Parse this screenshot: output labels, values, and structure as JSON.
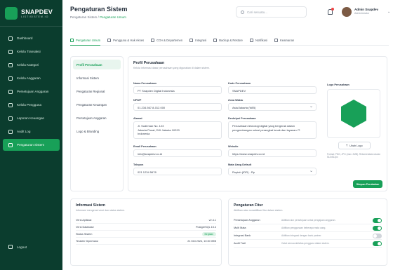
{
  "sidebar": {
    "brand": "SNAPDEV",
    "tagline": "L I S T I   S I S T E M . I O",
    "items": [
      {
        "label": "Dashboard",
        "icon": "home-icon"
      },
      {
        "label": "Kelola Transaksi",
        "icon": "receipt-icon"
      },
      {
        "label": "Kelola Kategori",
        "icon": "folder-icon"
      },
      {
        "label": "Kelola Anggaran",
        "icon": "wallet-icon"
      },
      {
        "label": "Persetujuan Anggaran",
        "icon": "check-circle-icon"
      },
      {
        "label": "Kelola Pengguna",
        "icon": "users-icon"
      },
      {
        "label": "Laporan Keuangan",
        "icon": "chart-icon"
      },
      {
        "label": "Audit Log",
        "icon": "clipboard-icon"
      },
      {
        "label": "Pengaturan Sistem",
        "icon": "gear-icon"
      }
    ],
    "active_index": 8,
    "logout": "Logout"
  },
  "header": {
    "title": "Pengaturan Sistem",
    "breadcrumb_root": "Pengaturan Sistem",
    "breadcrumb_sep": "/",
    "breadcrumb_current": "Pengaturan Umum",
    "search_placeholder": "Cari sesuatu...",
    "user_name": "Admin Snapdev",
    "user_role": "Administrator"
  },
  "tabs": [
    {
      "label": "Pengaturan Umum",
      "icon": "gear-icon"
    },
    {
      "label": "Pengguna & Hak Akses",
      "icon": "users-icon"
    },
    {
      "label": "COA & Departemen",
      "icon": "book-icon"
    },
    {
      "label": "Integrasi",
      "icon": "link-icon"
    },
    {
      "label": "Backup & Restore",
      "icon": "database-icon"
    },
    {
      "label": "Notifikasi",
      "icon": "bell-icon"
    },
    {
      "label": "Keamanan",
      "icon": "shield-icon"
    }
  ],
  "subnav": [
    "Profil Perusahaan",
    "Informasi Sistem",
    "Pengaturan Regional",
    "Pengaturan Keuangan",
    "Persetujuan Anggaran",
    "Logo & Branding"
  ],
  "profile": {
    "title": "Profil Perusahaan",
    "subtitle": "Kelola informasi dasar perusahaan yang digunakan di dalam sistem.",
    "fields": {
      "nama_label": "Nama Perusahaan",
      "nama_value": "PT Snapdev Digital Indonesia",
      "kode_label": "Kode Perusahaan",
      "kode_value": "SNAPDEV",
      "npwp_label": "NPWP",
      "npwp_value": "01.234.567.8-012.000",
      "zona_label": "Zona Waktu",
      "zona_value": "Asia/Jakarta (WIB)",
      "alamat_label": "Alamat",
      "alamat_value": "Jl. Sudirman No. 123\nJakarta Pusat, DKI Jakarta 10220\nIndonesia",
      "desk_label": "Deskripsi Perusahaan",
      "desk_value": "Perusahaan teknologi digital yang bergerak dalam\npengembangan solusi perangkat lunak dan layanan IT.",
      "email_label": "Email Perusahaan",
      "email_value": "info@snapdev.co.id",
      "website_label": "Website",
      "website_value": "https://www.snapdev.co.id",
      "telepon_label": "Telepon",
      "telepon_value": "021 1234 5678",
      "mata_label": "Mata Uang Default",
      "mata_value": "Rupiah (IDR) - Rp"
    },
    "logo_label": "Logo Perusahaan",
    "upload_label": "Ubah Logo",
    "upload_note": "Format: PNG, JPG (max. 2MB). Rekomendasi ukuran 512x512px",
    "save_label": "Simpan Perubahan"
  },
  "sysinfo": {
    "title": "Informasi Sistem",
    "subtitle": "Informasi mengenai versi dan status sistem.",
    "rows": [
      {
        "label": "Versi Aplikasi",
        "value": "v2.4.1"
      },
      {
        "label": "Versi Database",
        "value": "PostgreSQL 15.4"
      },
      {
        "label": "Status Sistem",
        "value": "Berjalan",
        "badge": true
      },
      {
        "label": "Terakhir Diperbarui",
        "value": "21 Mei 2024, 10:30 WIB"
      }
    ]
  },
  "features": {
    "title": "Pengaturan Fitur",
    "subtitle": "Aktifkan atau nonaktifkan fitur dalam sistem.",
    "rows": [
      {
        "label": "Persetujuan Anggaran",
        "desc": "Aktifkan alur persetujuan untuk pengajuan anggaran.",
        "on": true
      },
      {
        "label": "Multi Mata",
        "desc": "Aktifkan penggunaan beberapa mata uang.",
        "on": true
      },
      {
        "label": "Integrasi Bank",
        "desc": "Aktifkan integrasi dengan bank partner.",
        "on": false
      },
      {
        "label": "Audit Trail",
        "desc": "Catat semua aktivitas pengguna dalam sistem.",
        "on": true
      }
    ]
  },
  "colors": {
    "primary": "#18a058",
    "sidebar": "#0b3d2e"
  }
}
